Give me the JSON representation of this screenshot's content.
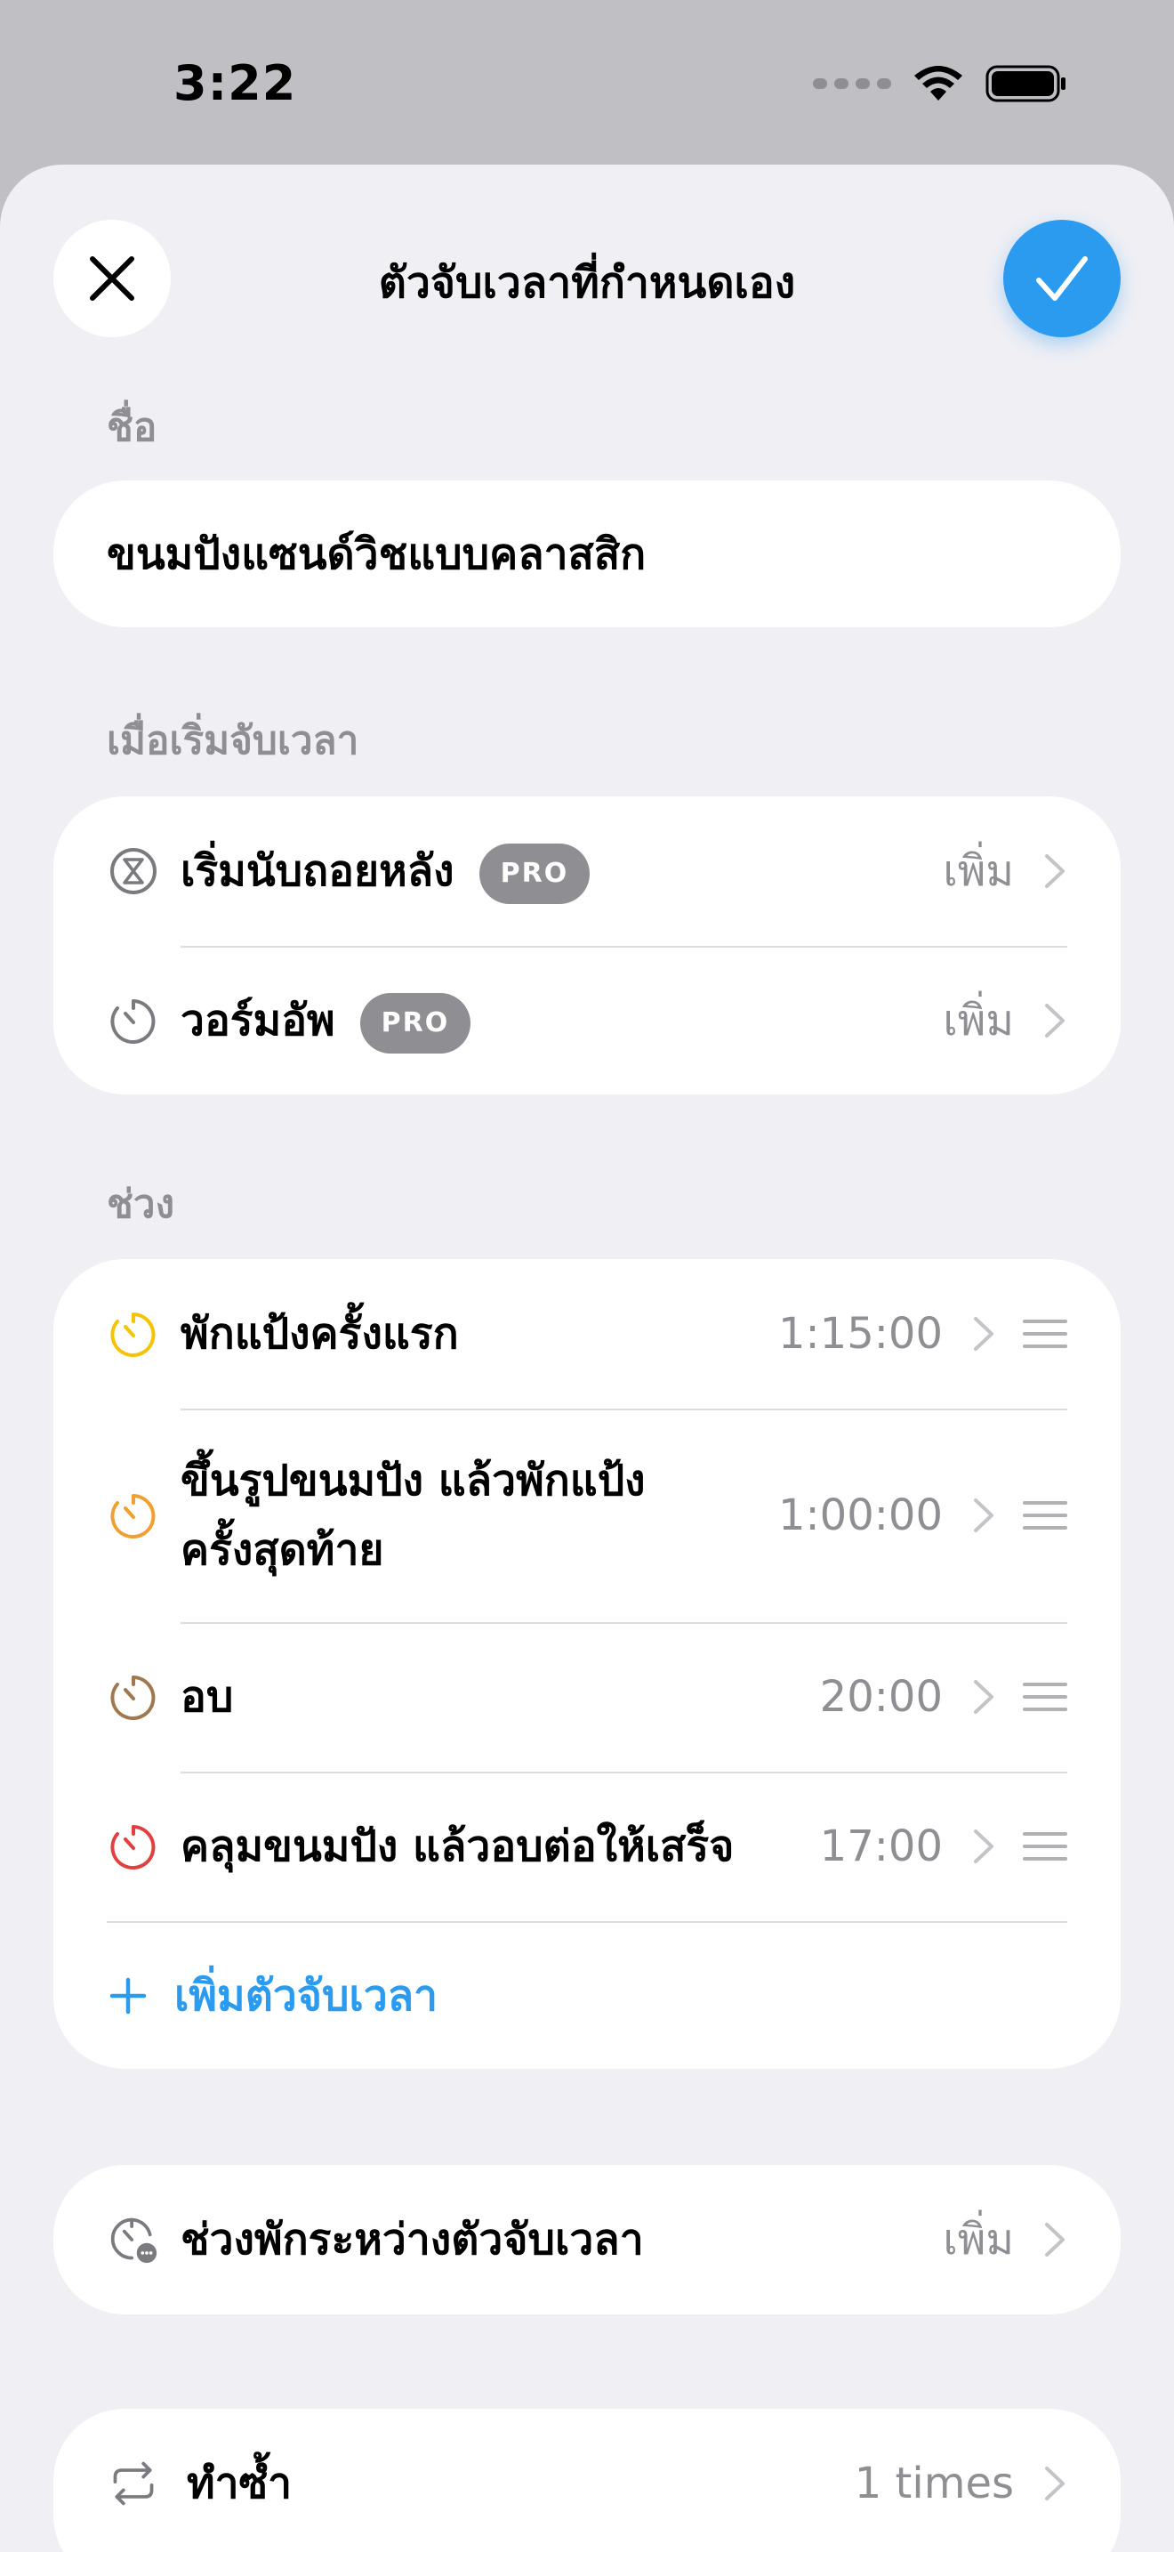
{
  "status_bar": {
    "time": "3:22"
  },
  "header": {
    "title": "ตัวจับเวลาที่กำหนดเอง"
  },
  "name_section": {
    "label": "ชื่อ",
    "value": "ขนมปังแซนด์วิชแบบคลาสสิก"
  },
  "on_start_section": {
    "label": "เมื่อเริ่มจับเวลา",
    "items": [
      {
        "label": "เริ่มนับถอยหลัง",
        "badge": "PRO",
        "value": "เพิ่ม"
      },
      {
        "label": "วอร์มอัพ",
        "badge": "PRO",
        "value": "เพิ่ม"
      }
    ]
  },
  "intervals_section": {
    "label": "ช่วง",
    "items": [
      {
        "label": "พักแป้งครั้งแรก",
        "value": "1:15:00",
        "color": "#f5c400"
      },
      {
        "label_line1": "ขึ้นรูปขนมปัง แล้วพักแป้ง",
        "label_line2": "ครั้งสุดท้าย",
        "value": "1:00:00",
        "color": "#f0a030"
      },
      {
        "label": "อบ",
        "value": "20:00",
        "color": "#a07850"
      },
      {
        "label": "คลุมขนมปัง แล้วอบต่อให้เสร็จ",
        "value": "17:00",
        "color": "#e04040"
      }
    ],
    "add_label": "เพิ่มตัวจับเวลา"
  },
  "rest_section": {
    "label": "ช่วงพักระหว่างตัวจับเวลา",
    "value": "เพิ่ม"
  },
  "repeat_section": {
    "label": "ทำซ้ำ",
    "value": "1 times"
  },
  "colors": {
    "accent": "#2b9bf0",
    "secondary_text": "#8e8e93",
    "background": "#efeff4"
  }
}
